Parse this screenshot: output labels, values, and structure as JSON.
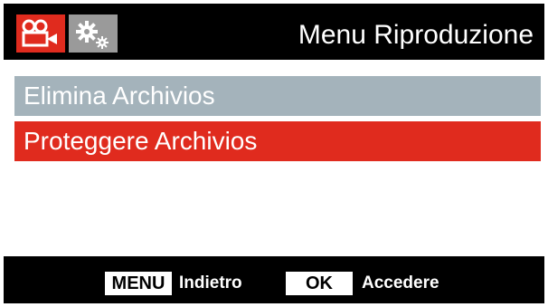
{
  "header": {
    "title": "Menu Riproduzione",
    "tabs": [
      {
        "icon": "video-camera-icon",
        "active": true
      },
      {
        "icon": "settings-gears-icon",
        "active": false
      }
    ]
  },
  "menu": {
    "items": [
      {
        "label": "Elimina Archivios",
        "selected": false
      },
      {
        "label": "Proteggere Archivios",
        "selected": true
      }
    ]
  },
  "footer": {
    "menu_key": "MENU",
    "menu_action": "Indietro",
    "ok_key": "OK",
    "ok_action": "Accedere"
  },
  "colors": {
    "accent": "#e02b1e",
    "item_bg": "#a4b3bb",
    "tab_inactive": "#9a9a9a",
    "background": "#000000"
  }
}
